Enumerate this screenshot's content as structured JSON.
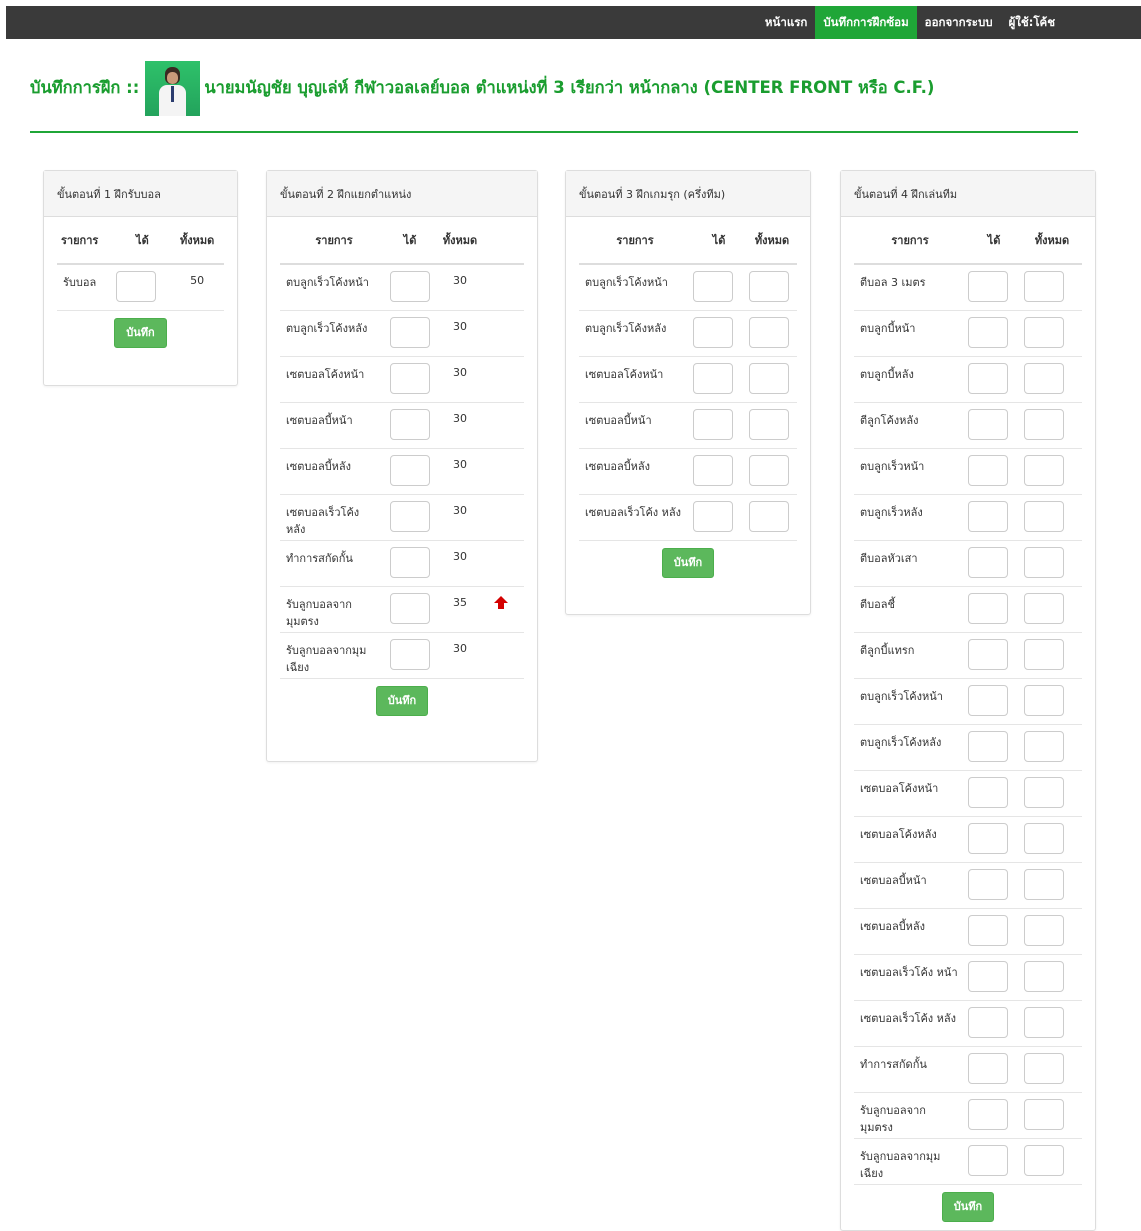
{
  "nav": {
    "items": [
      {
        "label": "หน้าแรก",
        "active": false
      },
      {
        "label": "บันทึกการฝึกซ้อม",
        "active": true
      },
      {
        "label": "ออกจากระบบ",
        "active": false
      },
      {
        "label": "ผู้ใช้:โค้ช",
        "active": false
      }
    ]
  },
  "heading": {
    "prefix": "บันทึกการฝึก ::",
    "text": "นายมนัญชัย บุญเล่ห์ กีฬาวอลเลย์บอล ตำแหน่งที่ 3 เรียกว่า หน้ากลาง (CENTER FRONT หรือ C.F.)"
  },
  "colors": {
    "accent": "#1fa637",
    "button": "#5cb85c",
    "arrow": "#d40000"
  },
  "panels": [
    {
      "title": "ขั้นตอนที่ 1 ฝึกรับบอล",
      "headers": {
        "item": "รายการ",
        "got": "ได้",
        "total": "ทั้งหมด"
      },
      "rows": [
        {
          "label": "รับบอล",
          "total": "50"
        }
      ],
      "save_label": "บันทึก"
    },
    {
      "title": "ขั้นตอนที่ 2 ฝึกแยกตำแหน่ง",
      "headers": {
        "item": "รายการ",
        "got": "ได้",
        "total": "ทั้งหมด"
      },
      "rows": [
        {
          "label": "ตบลูกเร็วโค้งหน้า",
          "total": "30"
        },
        {
          "label": "ตบลูกเร็วโค้งหลัง",
          "total": "30"
        },
        {
          "label": "เซตบอลโค้งหน้า",
          "total": "30"
        },
        {
          "label": "เซตบอลบี้หน้า",
          "total": "30"
        },
        {
          "label": "เซตบอลบี้หลัง",
          "total": "30"
        },
        {
          "label": "เซตบอลเร็วโค้ง หลัง",
          "total": "30"
        },
        {
          "label": "ทำการสกัดกั้น",
          "total": "30"
        },
        {
          "label": "รับลูกบอลจาก มุมตรง",
          "total": "35",
          "arrow": "up-arrow-icon"
        },
        {
          "label": "รับลูกบอลจากมุม เฉียง",
          "total": "30"
        }
      ],
      "save_label": "บันทึก"
    },
    {
      "title": "ขั้นตอนที่ 3 ฝึกเกมรุก (ครึ่งทีม)",
      "headers": {
        "item": "รายการ",
        "got": "ได้",
        "total": "ทั้งหมด"
      },
      "rows": [
        {
          "label": "ตบลูกเร็วโค้งหน้า"
        },
        {
          "label": "ตบลูกเร็วโค้งหลัง"
        },
        {
          "label": "เซตบอลโค้งหน้า"
        },
        {
          "label": "เซตบอลบี้หน้า"
        },
        {
          "label": "เซตบอลบี้หลัง"
        },
        {
          "label": "เซตบอลเร็วโค้ง หลัง"
        }
      ],
      "save_label": "บันทึก"
    },
    {
      "title": "ขั้นตอนที่ 4 ฝึกเล่นทีม",
      "headers": {
        "item": "รายการ",
        "got": "ได้",
        "total": "ทั้งหมด"
      },
      "rows": [
        {
          "label": "ตีบอล 3 เมตร"
        },
        {
          "label": "ตบลูกบี้หน้า"
        },
        {
          "label": "ตบลูกบี้หลัง"
        },
        {
          "label": "ตีลูกโค้งหลัง"
        },
        {
          "label": "ตบลูกเร็วหน้า"
        },
        {
          "label": "ตบลูกเร็วหลัง"
        },
        {
          "label": "ตีบอลหัวเสา"
        },
        {
          "label": "ตีบอลชี้"
        },
        {
          "label": "ตีลูกบี้แทรก"
        },
        {
          "label": "ตบลูกเร็วโค้งหน้า"
        },
        {
          "label": "ตบลูกเร็วโค้งหลัง"
        },
        {
          "label": "เซตบอลโค้งหน้า"
        },
        {
          "label": "เซตบอลโค้งหลัง"
        },
        {
          "label": "เซตบอลบี้หน้า"
        },
        {
          "label": "เซตบอลบี้หลัง"
        },
        {
          "label": "เซตบอลเร็วโค้ง หน้า"
        },
        {
          "label": "เซตบอลเร็วโค้ง หลัง"
        },
        {
          "label": "ทำการสกัดกั้น"
        },
        {
          "label": "รับลูกบอลจาก มุมตรง"
        },
        {
          "label": "รับลูกบอลจากมุม เฉียง"
        }
      ],
      "save_label": "บันทึก"
    }
  ]
}
